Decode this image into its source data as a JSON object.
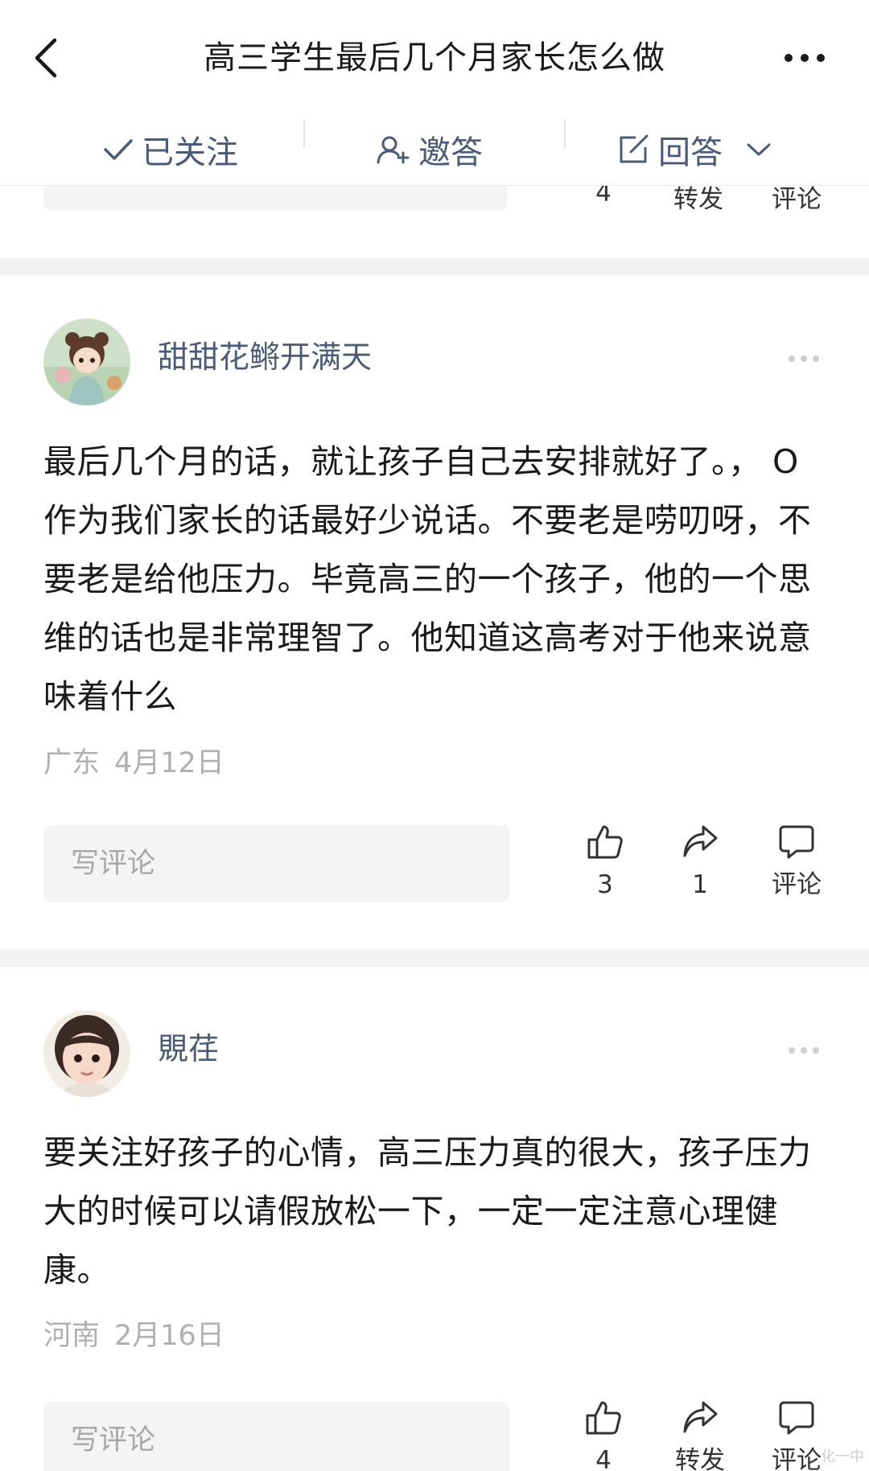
{
  "header": {
    "title": "高三学生最后几个月家长怎么做"
  },
  "actions": {
    "follow_label": "已关注",
    "invite_label": "邀答",
    "answer_label": "回答"
  },
  "previous_card": {
    "like_count": "4",
    "share_label": "转发",
    "comment_label": "评论"
  },
  "answers": [
    {
      "username": "甜甜花鳉开满天",
      "text": "最后几个月的话，就让孩子自己去安排就好了。， O作为我们家长的话最好少说话。不要老是唠叨呀，不要老是给他压力。毕竟高三的一个孩子，他的一个思维的话也是非常理智了。他知道这高考对于他来说意味着什么",
      "location": "广东",
      "date": "4月12日",
      "comment_placeholder": "写评论",
      "like_count": "3",
      "share_count": "1",
      "comment_label": "评论"
    },
    {
      "username": "覞荏",
      "text": "要关注好孩子的心情，高三压力真的很大，孩子压力大的时候可以请假放松一下，一定一定注意心理健康。",
      "location": "河南",
      "date": "2月16日",
      "comment_placeholder": "写评论",
      "like_count": "4",
      "share_label": "转发",
      "comment_label": "评论"
    }
  ],
  "watermark": "化一中",
  "colors": {
    "link_blue": "#4a5b78",
    "meta_gray": "#b0b0b0",
    "separator": "#f2f2f2",
    "input_bg": "#f4f4f4"
  },
  "icons": [
    "back-arrow-icon",
    "more-horizontal-icon",
    "check-icon",
    "invite-user-icon",
    "edit-icon",
    "chevron-down-icon",
    "thumbs-up-icon",
    "share-icon",
    "comment-bubble-icon"
  ]
}
